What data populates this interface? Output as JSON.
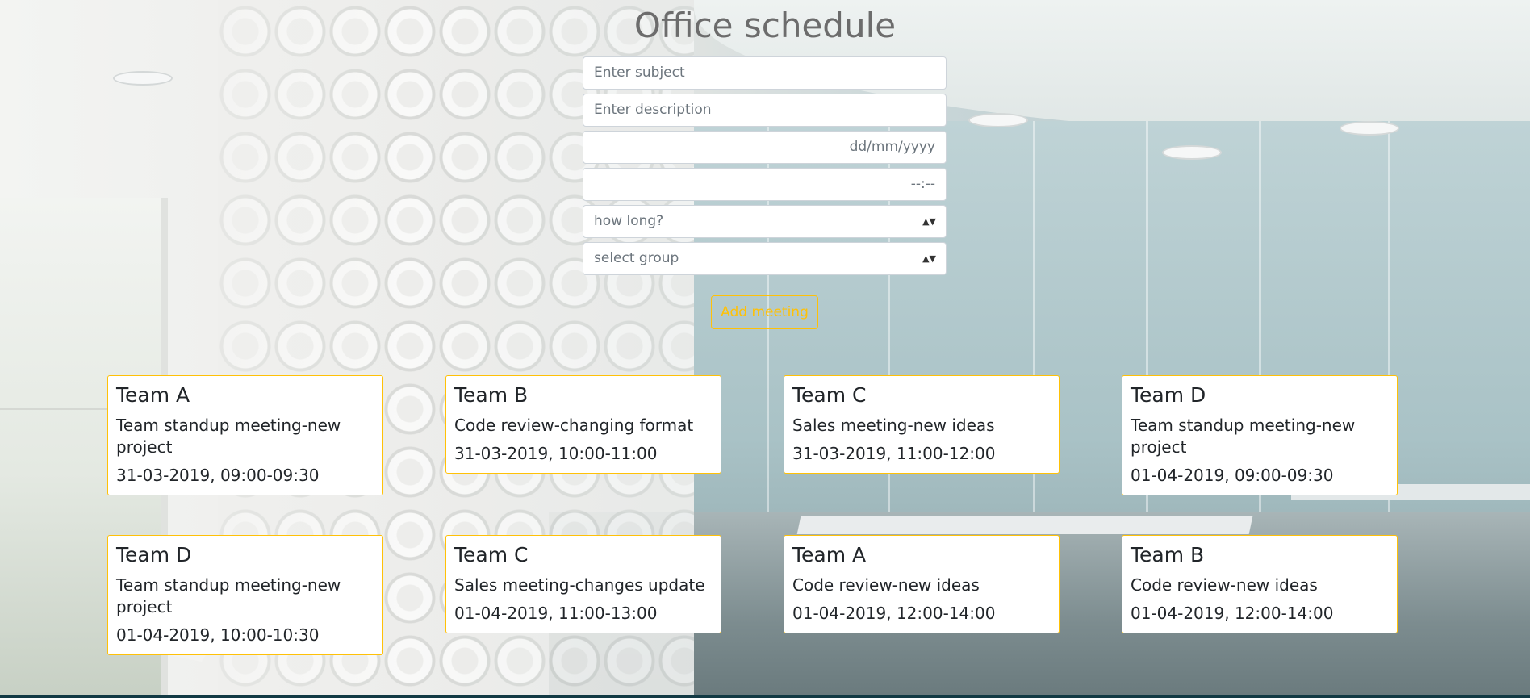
{
  "page": {
    "title": "Office schedule"
  },
  "form": {
    "subject_placeholder": "Enter subject",
    "description_placeholder": "Enter description",
    "date_placeholder": "dd/mm/yyyy",
    "time_placeholder": "--:--",
    "duration_select": "how long?",
    "group_select": "select group",
    "add_label": "Add meeting"
  },
  "colors": {
    "accent": "#ffc107",
    "title": "#6c6c6c",
    "card_text": "#212529"
  },
  "meetings": [
    {
      "team": "Team A",
      "description": "Team standup meeting-new project",
      "when": "31-03-2019, 09:00-09:30"
    },
    {
      "team": "Team B",
      "description": "Code review-changing format",
      "when": "31-03-2019, 10:00-11:00"
    },
    {
      "team": "Team C",
      "description": "Sales meeting-new ideas",
      "when": "31-03-2019, 11:00-12:00"
    },
    {
      "team": "Team D",
      "description": "Team standup meeting-new project",
      "when": "01-04-2019, 09:00-09:30"
    },
    {
      "team": "Team D",
      "description": "Team standup meeting-new project",
      "when": "01-04-2019, 10:00-10:30"
    },
    {
      "team": "Team C",
      "description": "Sales meeting-changes update",
      "when": "01-04-2019, 11:00-13:00"
    },
    {
      "team": "Team A",
      "description": "Code review-new ideas",
      "when": "01-04-2019, 12:00-14:00"
    },
    {
      "team": "Team B",
      "description": "Code review-new ideas",
      "when": "01-04-2019, 12:00-14:00"
    }
  ]
}
